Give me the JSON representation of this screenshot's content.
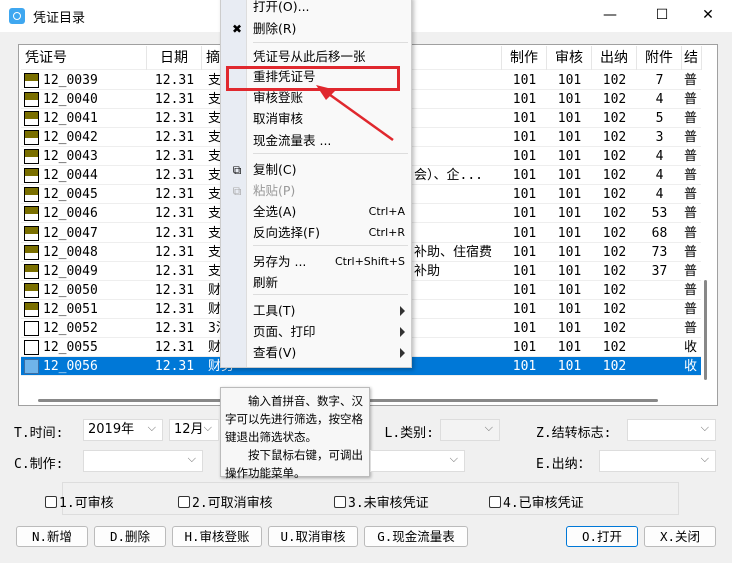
{
  "window": {
    "title": "凭证目录",
    "minimize": "—",
    "maximize": "☐",
    "close": "✕"
  },
  "table": {
    "headers": [
      "凭证号",
      "日期",
      "摘",
      "制作",
      "审核",
      "出纳",
      "附件",
      "结"
    ],
    "rows": [
      {
        "no": "12_0039",
        "date": "12.31",
        "summary": "支",
        "tail": "",
        "maker": "101",
        "auditor": "101",
        "cashier": "102",
        "attach": "7",
        "flag": "普",
        "status": "audited"
      },
      {
        "no": "12_0040",
        "date": "12.31",
        "summary": "支",
        "tail": "",
        "maker": "101",
        "auditor": "101",
        "cashier": "102",
        "attach": "4",
        "flag": "普",
        "status": "audited"
      },
      {
        "no": "12_0041",
        "date": "12.31",
        "summary": "支",
        "tail": "",
        "maker": "101",
        "auditor": "101",
        "cashier": "102",
        "attach": "5",
        "flag": "普",
        "status": "audited"
      },
      {
        "no": "12_0042",
        "date": "12.31",
        "summary": "支",
        "tail": "",
        "maker": "101",
        "auditor": "101",
        "cashier": "102",
        "attach": "3",
        "flag": "普",
        "status": "audited"
      },
      {
        "no": "12_0043",
        "date": "12.31",
        "summary": "支",
        "tail": "",
        "maker": "101",
        "auditor": "101",
        "cashier": "102",
        "attach": "4",
        "flag": "普",
        "status": "audited"
      },
      {
        "no": "12_0044",
        "date": "12.31",
        "summary": "支",
        "tail": "会）、企...",
        "maker": "101",
        "auditor": "101",
        "cashier": "102",
        "attach": "4",
        "flag": "普",
        "status": "audited"
      },
      {
        "no": "12_0045",
        "date": "12.31",
        "summary": "支",
        "tail": "",
        "maker": "101",
        "auditor": "101",
        "cashier": "102",
        "attach": "4",
        "flag": "普",
        "status": "audited"
      },
      {
        "no": "12_0046",
        "date": "12.31",
        "summary": "支",
        "tail": "",
        "maker": "101",
        "auditor": "101",
        "cashier": "102",
        "attach": "53",
        "flag": "普",
        "status": "audited"
      },
      {
        "no": "12_0047",
        "date": "12.31",
        "summary": "支",
        "tail": "",
        "maker": "101",
        "auditor": "101",
        "cashier": "102",
        "attach": "68",
        "flag": "普",
        "status": "audited"
      },
      {
        "no": "12_0048",
        "date": "12.31",
        "summary": "支",
        "tail": "补助、住宿费",
        "maker": "101",
        "auditor": "101",
        "cashier": "102",
        "attach": "73",
        "flag": "普",
        "status": "audited"
      },
      {
        "no": "12_0049",
        "date": "12.31",
        "summary": "支",
        "tail": "补助",
        "maker": "101",
        "auditor": "101",
        "cashier": "102",
        "attach": "37",
        "flag": "普",
        "status": "audited"
      },
      {
        "no": "12_0050",
        "date": "12.31",
        "summary": "财",
        "tail": "",
        "maker": "101",
        "auditor": "101",
        "cashier": "102",
        "attach": "",
        "flag": "普",
        "status": "audited"
      },
      {
        "no": "12_0051",
        "date": "12.31",
        "summary": "财",
        "tail": "",
        "maker": "101",
        "auditor": "101",
        "cashier": "102",
        "attach": "",
        "flag": "普",
        "status": "audited"
      },
      {
        "no": "12_0052",
        "date": "12.31",
        "summary": "3法",
        "tail": "",
        "maker": "101",
        "auditor": "101",
        "cashier": "102",
        "attach": "",
        "flag": "普",
        "status": "empty"
      },
      {
        "no": "12_0055",
        "date": "12.31",
        "summary": "财",
        "tail": "",
        "maker": "101",
        "auditor": "101",
        "cashier": "102",
        "attach": "",
        "flag": "收",
        "status": "empty"
      },
      {
        "no": "12_0056",
        "date": "12.31",
        "summary": "财务",
        "tail": "",
        "maker": "101",
        "auditor": "101",
        "cashier": "102",
        "attach": "",
        "flag": "收",
        "status": "selected"
      }
    ]
  },
  "context_menu": {
    "items": [
      {
        "label": "打开(O)...",
        "shortcut": ""
      },
      {
        "label": "删除(R)",
        "shortcut": "",
        "icon": "close-icon"
      },
      {
        "label": "凭证号从此后移一张",
        "shortcut": ""
      },
      {
        "label": "重排凭证号",
        "shortcut": "",
        "highlighted": true
      },
      {
        "label": "审核登账",
        "shortcut": ""
      },
      {
        "label": "取消审核",
        "shortcut": ""
      },
      {
        "label": "现金流量表 ...",
        "shortcut": ""
      },
      {
        "label": "复制(C)",
        "shortcut": "",
        "icon": "copy-icon"
      },
      {
        "label": "粘贴(P)",
        "shortcut": "",
        "disabled": true,
        "icon": "paste-icon"
      },
      {
        "label": "全选(A)",
        "shortcut": "Ctrl+A"
      },
      {
        "label": "反向选择(F)",
        "shortcut": "Ctrl+R"
      },
      {
        "label": "另存为 ...",
        "shortcut": "Ctrl+Shift+S"
      },
      {
        "label": "刷新",
        "shortcut": ""
      },
      {
        "label": "工具(T)",
        "shortcut": "",
        "submenu": true
      },
      {
        "label": "页面、打印",
        "shortcut": "",
        "submenu": true
      },
      {
        "label": "查看(V)",
        "shortcut": "",
        "submenu": true
      }
    ]
  },
  "tooltip": {
    "line1": "　　输入首拼音、数字、汉字可以先进行筛选，按空格键退出筛选状态。",
    "line2": "　　按下鼠标右键，可调出操作功能菜单。"
  },
  "filters": {
    "time_label": "T.时间:",
    "year": "2019年",
    "month": "12月",
    "category_label": "L.类别:",
    "category": "",
    "carry_label": "Z.结转标志:",
    "carry": "",
    "maker_label": "C.制作:",
    "maker": "",
    "auditor": "",
    "cashier_label": "E.出纳：",
    "cashier": ""
  },
  "checkboxes": [
    "1.可审核",
    "2.可取消审核",
    "3.未审核凭证",
    "4.已审核凭证"
  ],
  "buttons": [
    "N.新增",
    "D.删除",
    "H.审核登账",
    "U.取消审核",
    "G.现金流量表",
    "O.打开",
    "X.关闭"
  ],
  "colors": {
    "selection": "#0078d7",
    "annotation": "#e0282e",
    "audited_mark": "#7a6f00"
  }
}
